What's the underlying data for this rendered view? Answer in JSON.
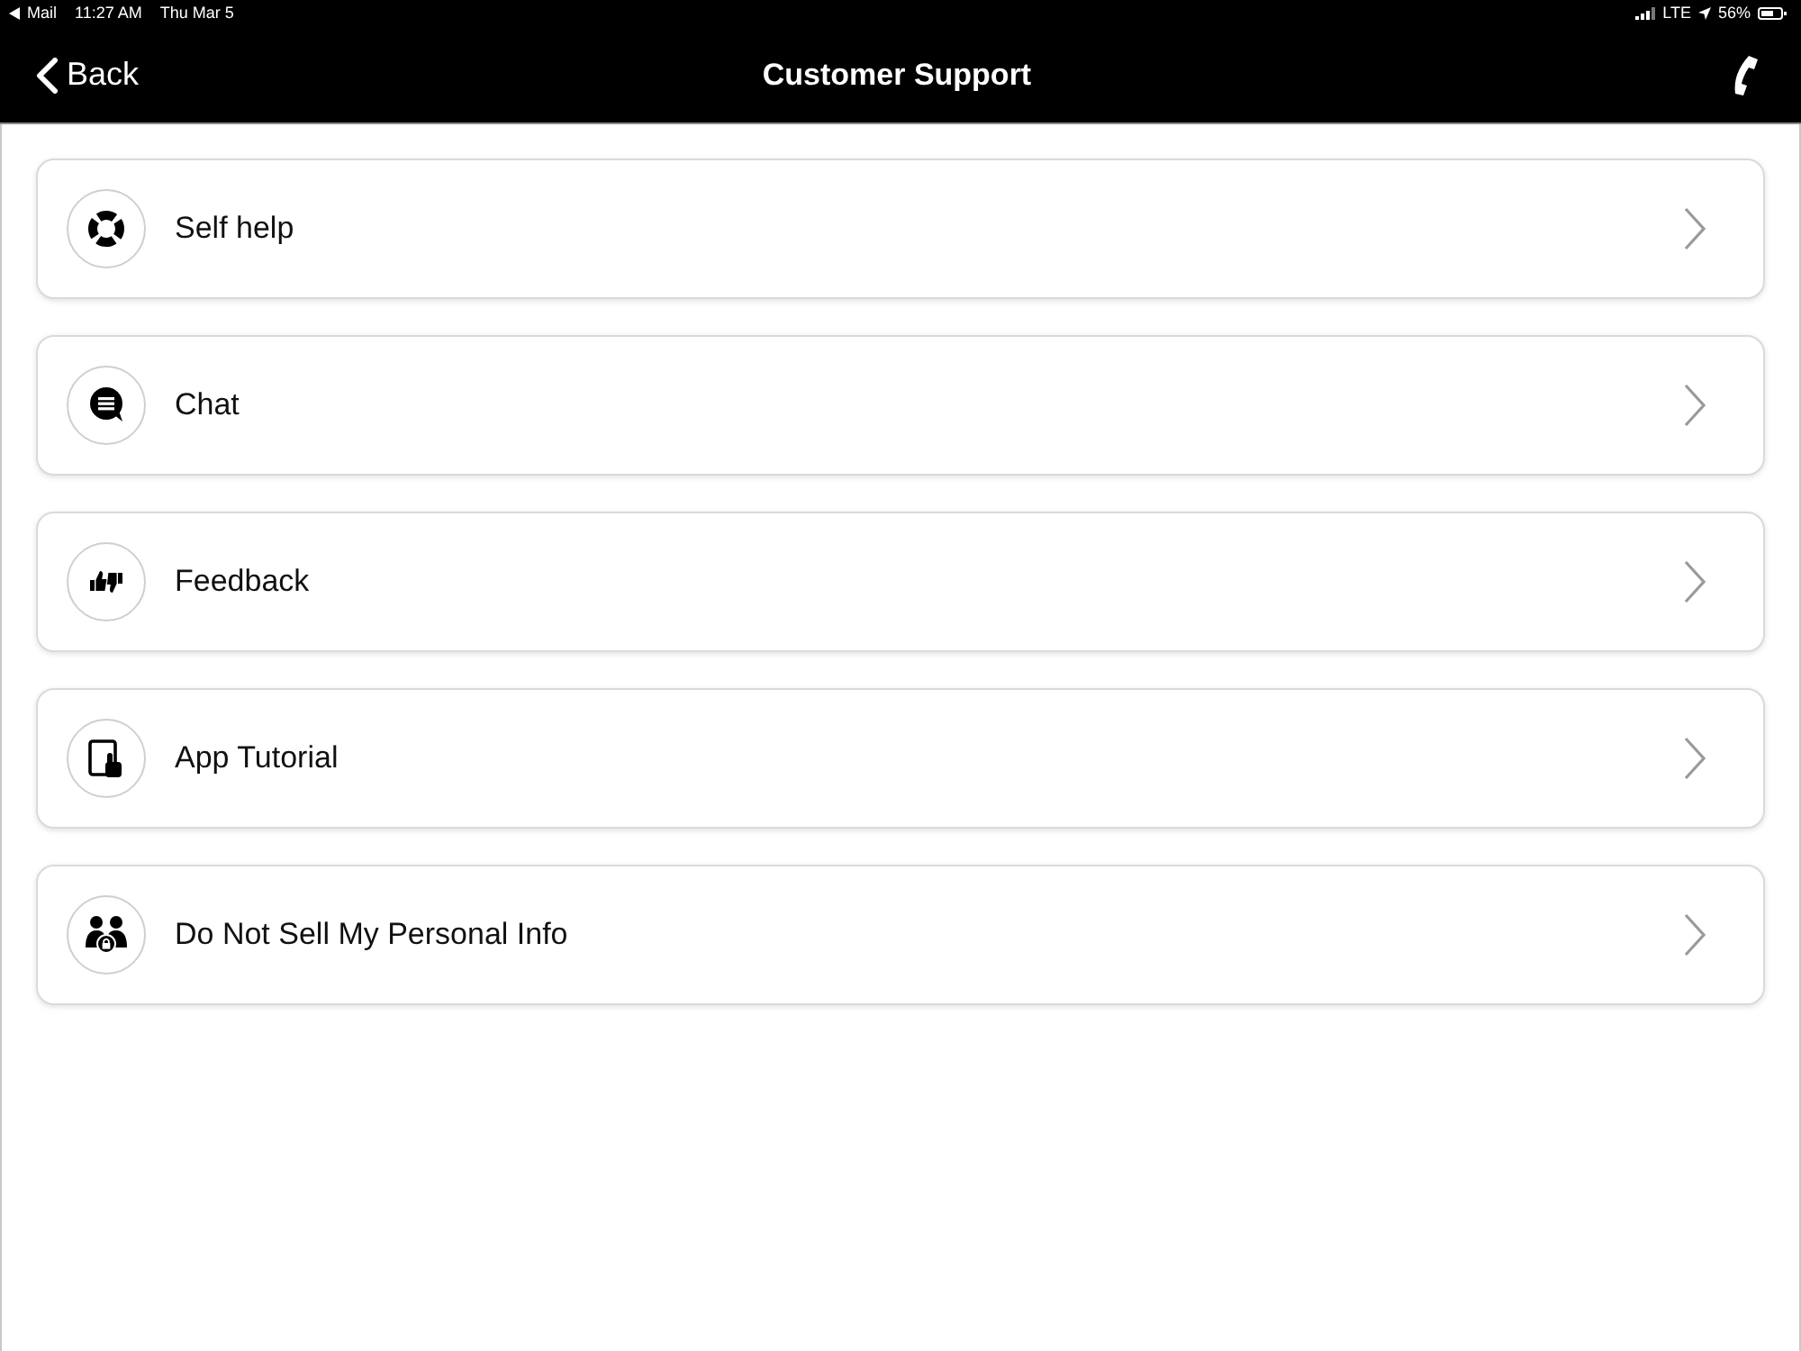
{
  "status_bar": {
    "back_app": "Mail",
    "time": "11:27 AM",
    "date": "Thu Mar 5",
    "network": "LTE",
    "battery": "56%"
  },
  "nav_bar": {
    "back_label": "Back",
    "title": "Customer Support"
  },
  "menu_items": [
    {
      "label": "Self help",
      "kind": "lifebuoy"
    },
    {
      "label": "Chat",
      "kind": "chat"
    },
    {
      "label": "Feedback",
      "kind": "feedback"
    },
    {
      "label": "App Tutorial",
      "kind": "tutorial"
    },
    {
      "label": "Do Not Sell My Personal Info",
      "kind": "privacy"
    }
  ]
}
